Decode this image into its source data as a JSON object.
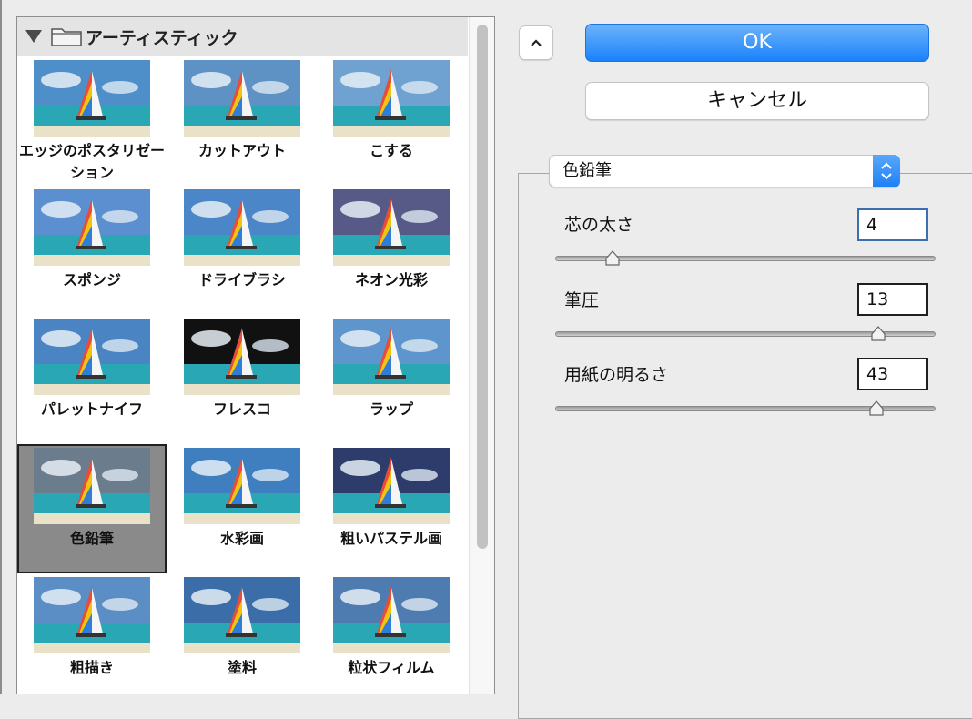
{
  "gallery": {
    "category": "アーティスティック",
    "filters": [
      {
        "label": "エッジのポスタリゼーション",
        "icon": "filter-thumbnail-icon"
      },
      {
        "label": "カットアウト",
        "icon": "filter-thumbnail-icon"
      },
      {
        "label": "こする",
        "icon": "filter-thumbnail-icon"
      },
      {
        "label": "スポンジ",
        "icon": "filter-thumbnail-icon"
      },
      {
        "label": "ドライブラシ",
        "icon": "filter-thumbnail-icon"
      },
      {
        "label": "ネオン光彩",
        "icon": "filter-thumbnail-icon"
      },
      {
        "label": "パレットナイフ",
        "icon": "filter-thumbnail-icon"
      },
      {
        "label": "フレスコ",
        "icon": "filter-thumbnail-icon"
      },
      {
        "label": "ラップ",
        "icon": "filter-thumbnail-icon"
      },
      {
        "label": "色鉛筆",
        "icon": "filter-thumbnail-icon",
        "selected": true
      },
      {
        "label": "水彩画",
        "icon": "filter-thumbnail-icon"
      },
      {
        "label": "粗いパステル画",
        "icon": "filter-thumbnail-icon"
      },
      {
        "label": "粗描き",
        "icon": "filter-thumbnail-icon"
      },
      {
        "label": "塗料",
        "icon": "filter-thumbnail-icon"
      },
      {
        "label": "粒状フィルム",
        "icon": "filter-thumbnail-icon"
      }
    ]
  },
  "buttons": {
    "ok_label": "OK",
    "cancel_label": "キャンセル"
  },
  "settings": {
    "selected_filter": "色鉛筆",
    "params": [
      {
        "label": "芯の太さ",
        "value": "4",
        "slider_fraction": 0.15
      },
      {
        "label": "筆圧",
        "value": "13",
        "slider_fraction": 0.85
      },
      {
        "label": "用紙の明るさ",
        "value": "43",
        "slider_fraction": 0.845
      }
    ]
  },
  "colors": {
    "accent": "#1a82fb",
    "selected_tile": "#8a8a8a"
  }
}
